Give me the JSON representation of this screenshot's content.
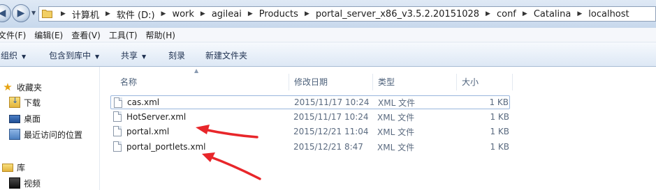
{
  "address": {
    "crumbs": [
      "计算机",
      "软件 (D:)",
      "work",
      "agileai",
      "Products",
      "portal_server_x86_v3.5.2.20151028",
      "conf",
      "Catalina",
      "localhost"
    ]
  },
  "menu": [
    "文件(F)",
    "编辑(E)",
    "查看(V)",
    "工具(T)",
    "帮助(H)"
  ],
  "toolbar": {
    "organize": "组织",
    "include_library": "包含到库中",
    "share": "共享",
    "burn": "刻录",
    "new_folder": "新建文件夹"
  },
  "nav": {
    "favorites": "收藏夹",
    "downloads": "下载",
    "desktop": "桌面",
    "recent": "最近访问的位置",
    "libraries": "库",
    "videos": "视频"
  },
  "columns": {
    "name": "名称",
    "date": "修改日期",
    "type": "类型",
    "size": "大小"
  },
  "files": [
    {
      "name": "cas.xml",
      "date": "2015/11/17 10:24",
      "type": "XML 文件",
      "size": "1 KB"
    },
    {
      "name": "HotServer.xml",
      "date": "2015/11/17 10:24",
      "type": "XML 文件",
      "size": "1 KB"
    },
    {
      "name": "portal.xml",
      "date": "2015/12/21 11:04",
      "type": "XML 文件",
      "size": "1 KB"
    },
    {
      "name": "portal_portlets.xml",
      "date": "2015/12/21 8:47",
      "type": "XML 文件",
      "size": "1 KB"
    }
  ],
  "annotation_color": "#e8262a"
}
